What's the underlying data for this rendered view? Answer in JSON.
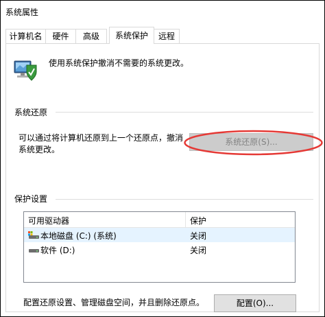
{
  "window": {
    "title": "系统属性"
  },
  "tabs": [
    {
      "label": "计算机名"
    },
    {
      "label": "硬件"
    },
    {
      "label": "高级"
    },
    {
      "label": "系统保护"
    },
    {
      "label": "远程"
    }
  ],
  "intro": {
    "text": "使用系统保护撤消不需要的系统更改。",
    "icon": "computer-shield-icon"
  },
  "system_restore": {
    "group_title": "系统还原",
    "description_line1": "可以通过将计算机还原到上一个还原点，撤消",
    "description_line2": "系统更改。",
    "button_label": "系统还原(S)...",
    "button_enabled": false,
    "highlight_color": "#e53935"
  },
  "protection_settings": {
    "group_title": "保护设置",
    "columns": {
      "drive": "可用驱动器",
      "protection": "保护"
    },
    "rows": [
      {
        "drive": "本地磁盘 (C:) (系统)",
        "protection": "关闭",
        "icon": "system-drive-icon",
        "selected": true
      },
      {
        "drive": "软件 (D:)",
        "protection": "关闭",
        "icon": "drive-icon",
        "selected": false
      }
    ]
  },
  "configure": {
    "text": "配置还原设置、管理磁盘空间，并且删除还原点。",
    "button_label": "配置(O)..."
  }
}
